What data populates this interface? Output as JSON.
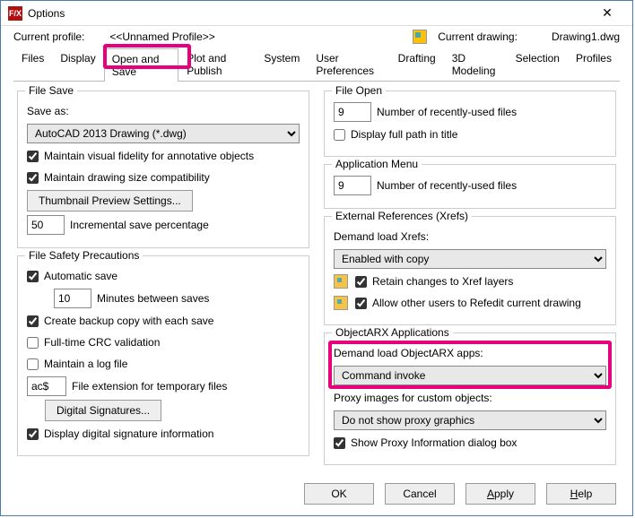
{
  "title": "Options",
  "profile_label": "Current profile:",
  "profile_value": "<<Unnamed Profile>>",
  "drawing_label": "Current drawing:",
  "drawing_value": "Drawing1.dwg",
  "tabs": [
    "Files",
    "Display",
    "Open and Save",
    "Plot and Publish",
    "System",
    "User Preferences",
    "Drafting",
    "3D Modeling",
    "Selection",
    "Profiles"
  ],
  "fileSave": {
    "title": "File Save",
    "saveAsLabel": "Save as:",
    "saveAsValue": "AutoCAD 2013 Drawing (*.dwg)",
    "maintainVisual": "Maintain visual fidelity for annotative objects",
    "maintainSize": "Maintain drawing size compatibility",
    "thumbBtn": "Thumbnail Preview Settings...",
    "incrVal": "50",
    "incrLbl": "Incremental save percentage"
  },
  "safety": {
    "title": "File Safety Precautions",
    "auto": "Automatic save",
    "minsVal": "10",
    "minsLbl": "Minutes between saves",
    "backup": "Create backup copy with each save",
    "crc": "Full-time CRC validation",
    "log": "Maintain a log file",
    "extVal": "ac$",
    "extLbl": "File extension for temporary files",
    "sigBtn": "Digital Signatures...",
    "dispSig": "Display digital signature information"
  },
  "fileOpen": {
    "title": "File Open",
    "recentVal": "9",
    "recentLbl": "Number of recently-used files",
    "fullPath": "Display full path in title"
  },
  "appMenu": {
    "title": "Application Menu",
    "recentVal": "9",
    "recentLbl": "Number of recently-used files"
  },
  "xrefs": {
    "title": "External References (Xrefs)",
    "demandLbl": "Demand load Xrefs:",
    "demandVal": "Enabled with copy",
    "retain": "Retain changes to Xref layers",
    "allow": "Allow other users to Refedit current drawing"
  },
  "arx": {
    "title": "ObjectARX Applications",
    "demandLbl": "Demand load ObjectARX apps:",
    "demandVal": "Command invoke",
    "proxyLbl": "Proxy images for custom objects:",
    "proxyVal": "Do not show proxy graphics",
    "showProxy": "Show Proxy Information dialog box"
  },
  "buttons": {
    "ok": "OK",
    "cancel": "Cancel",
    "apply": "Apply",
    "help": "Help"
  }
}
